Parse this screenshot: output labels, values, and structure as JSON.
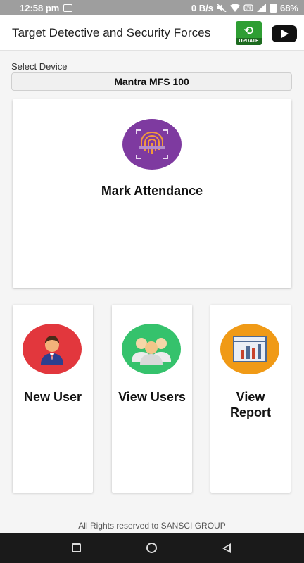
{
  "status_bar": {
    "time": "12:58 pm",
    "net_speed": "0 B/s",
    "battery": "68%"
  },
  "app_bar": {
    "title": "Target Detective and Security Forces",
    "update_label": "UPDATE",
    "update_icon": "update-arrow-icon",
    "youtube_icon": "youtube-play-icon"
  },
  "device": {
    "label": "Select Device",
    "selected": "Mantra MFS 100"
  },
  "main_card": {
    "title": "Mark Attendance",
    "icon": "fingerprint-icon",
    "color": "#7e3aa0"
  },
  "cards": [
    {
      "title": "New User",
      "icon": "user-avatar-icon",
      "color": "#e2373d"
    },
    {
      "title": "View Users",
      "icon": "users-group-icon",
      "color": "#35c26c"
    },
    {
      "title": "View Report",
      "icon": "report-chart-icon",
      "color": "#f09a16"
    }
  ],
  "footer": {
    "text": "All Rights reserved to SANSCI GROUP"
  },
  "nav": {
    "recents": "square-icon",
    "home": "circle-icon",
    "back": "triangle-back-icon"
  }
}
